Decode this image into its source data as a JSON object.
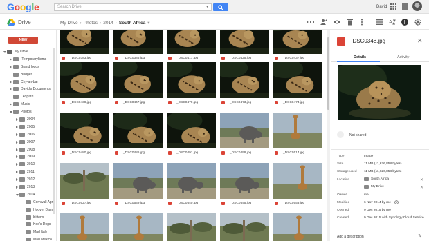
{
  "logo": {
    "letters": [
      "G",
      "o",
      "o",
      "g",
      "l",
      "e"
    ],
    "colors": [
      "#4285f4",
      "#ea4335",
      "#fbbc05",
      "#4285f4",
      "#34a853",
      "#ea4335"
    ]
  },
  "search": {
    "placeholder": "Search Drive"
  },
  "account": {
    "name": "David"
  },
  "app": {
    "name": "Drive"
  },
  "breadcrumb": {
    "items": [
      "My Drive",
      "Photos",
      "2014",
      "South Africa"
    ]
  },
  "sidebar": {
    "new_label": "NEW",
    "tree": [
      {
        "label": "My Drive",
        "indent": 0,
        "arrow": "down",
        "kind": "drive"
      },
      {
        "label": ".TemporaryItems",
        "indent": 1,
        "arrow": "right",
        "kind": "folder"
      },
      {
        "label": "Brand logos",
        "indent": 1,
        "arrow": "right",
        "kind": "folder"
      },
      {
        "label": "Budget",
        "indent": 1,
        "arrow": "",
        "kind": "folder"
      },
      {
        "label": "Chy-an-bar",
        "indent": 1,
        "arrow": "right",
        "kind": "folder"
      },
      {
        "label": "David's Documents",
        "indent": 1,
        "arrow": "right",
        "kind": "folder"
      },
      {
        "label": "Leopard",
        "indent": 1,
        "arrow": "",
        "kind": "folder"
      },
      {
        "label": "Music",
        "indent": 1,
        "arrow": "right",
        "kind": "folder"
      },
      {
        "label": "Photos",
        "indent": 1,
        "arrow": "down",
        "kind": "folder"
      },
      {
        "label": "2004",
        "indent": 2,
        "arrow": "right",
        "kind": "folder"
      },
      {
        "label": "2005",
        "indent": 2,
        "arrow": "right",
        "kind": "folder"
      },
      {
        "label": "2006",
        "indent": 2,
        "arrow": "right",
        "kind": "folder"
      },
      {
        "label": "2007",
        "indent": 2,
        "arrow": "right",
        "kind": "folder"
      },
      {
        "label": "2008",
        "indent": 2,
        "arrow": "right",
        "kind": "folder"
      },
      {
        "label": "2009",
        "indent": 2,
        "arrow": "right",
        "kind": "folder"
      },
      {
        "label": "2010",
        "indent": 2,
        "arrow": "right",
        "kind": "folder"
      },
      {
        "label": "2011",
        "indent": 2,
        "arrow": "right",
        "kind": "folder"
      },
      {
        "label": "2012",
        "indent": 2,
        "arrow": "right",
        "kind": "folder"
      },
      {
        "label": "2013",
        "indent": 2,
        "arrow": "right",
        "kind": "folder"
      },
      {
        "label": "2014",
        "indent": 2,
        "arrow": "down",
        "kind": "folder"
      },
      {
        "label": "Cornwall April",
        "indent": 3,
        "arrow": "",
        "kind": "folder"
      },
      {
        "label": "Hoover Dam",
        "indent": 3,
        "arrow": "",
        "kind": "folder"
      },
      {
        "label": "Kittens",
        "indent": 3,
        "arrow": "",
        "kind": "folder"
      },
      {
        "label": "Koo's Dogs",
        "indent": 3,
        "arrow": "",
        "kind": "folder"
      },
      {
        "label": "Mad Italy",
        "indent": 3,
        "arrow": "",
        "kind": "folder"
      },
      {
        "label": "Mad Mexico",
        "indent": 3,
        "arrow": "",
        "kind": "folder"
      }
    ]
  },
  "files": [
    {
      "name": "_DSC0383.jpg",
      "scene": "dark"
    },
    {
      "name": "_DSC0386.jpg",
      "scene": "dark"
    },
    {
      "name": "_DSC0417.jpg",
      "scene": "dark"
    },
    {
      "name": "_DSC0425.jpg",
      "scene": "dark"
    },
    {
      "name": "_DSC0437.jpg",
      "scene": "dark"
    },
    {
      "name": "_DSC0438.jpg",
      "scene": "dark"
    },
    {
      "name": "_DSC0447.jpg",
      "scene": "dark"
    },
    {
      "name": "_DSC0470.jpg",
      "scene": "dark"
    },
    {
      "name": "_DSC0473.jpg",
      "scene": "dark"
    },
    {
      "name": "_DSC0474.jpg",
      "scene": "dark"
    },
    {
      "name": "_DSC0480.jpg",
      "scene": "dark"
    },
    {
      "name": "_DSC0486.jpg",
      "scene": "dark"
    },
    {
      "name": "_DSC0491.jpg",
      "scene": "dark"
    },
    {
      "name": "_DSC0499.jpg",
      "scene": "elephant"
    },
    {
      "name": "_DSC0514.jpg",
      "scene": "giraffe"
    },
    {
      "name": "_DSC0527.jpg",
      "scene": "bush"
    },
    {
      "name": "_DSC0539.jpg",
      "scene": "elephant"
    },
    {
      "name": "_DSC0540.jpg",
      "scene": "elephant"
    },
    {
      "name": "_DSC0545.jpg",
      "scene": "elephant"
    },
    {
      "name": "_DSC0553.jpg",
      "scene": "giraffe"
    },
    {
      "name": "",
      "scene": "giraffe"
    },
    {
      "name": "",
      "scene": "giraffe"
    },
    {
      "name": "",
      "scene": "bush"
    },
    {
      "name": "",
      "scene": "bush"
    },
    {
      "name": "",
      "scene": "giraffe"
    }
  ],
  "details": {
    "title": "_DSC0348.jpg",
    "tabs": [
      "Details",
      "Activity"
    ],
    "sharing": "Not shared",
    "props": {
      "type_label": "Type",
      "type_value": "Image",
      "size_label": "Size",
      "size_value": "11 MB (11,626,858 bytes)",
      "storage_label": "Storage used",
      "storage_value": "11 MB (11,626,858 bytes)",
      "location_label": "Location",
      "location_1": "South Africa",
      "location_2": "My Drive",
      "owner_label": "Owner",
      "owner_value": "me",
      "modified_label": "Modified",
      "modified_value": "6 Nov 2014 by me",
      "opened_label": "Opened",
      "opened_value": "9 Dec 2015 by me",
      "created_label": "Created",
      "created_value": "9 Dec 2015 with Synology Cloud Service"
    },
    "add_description": "Add a description"
  }
}
